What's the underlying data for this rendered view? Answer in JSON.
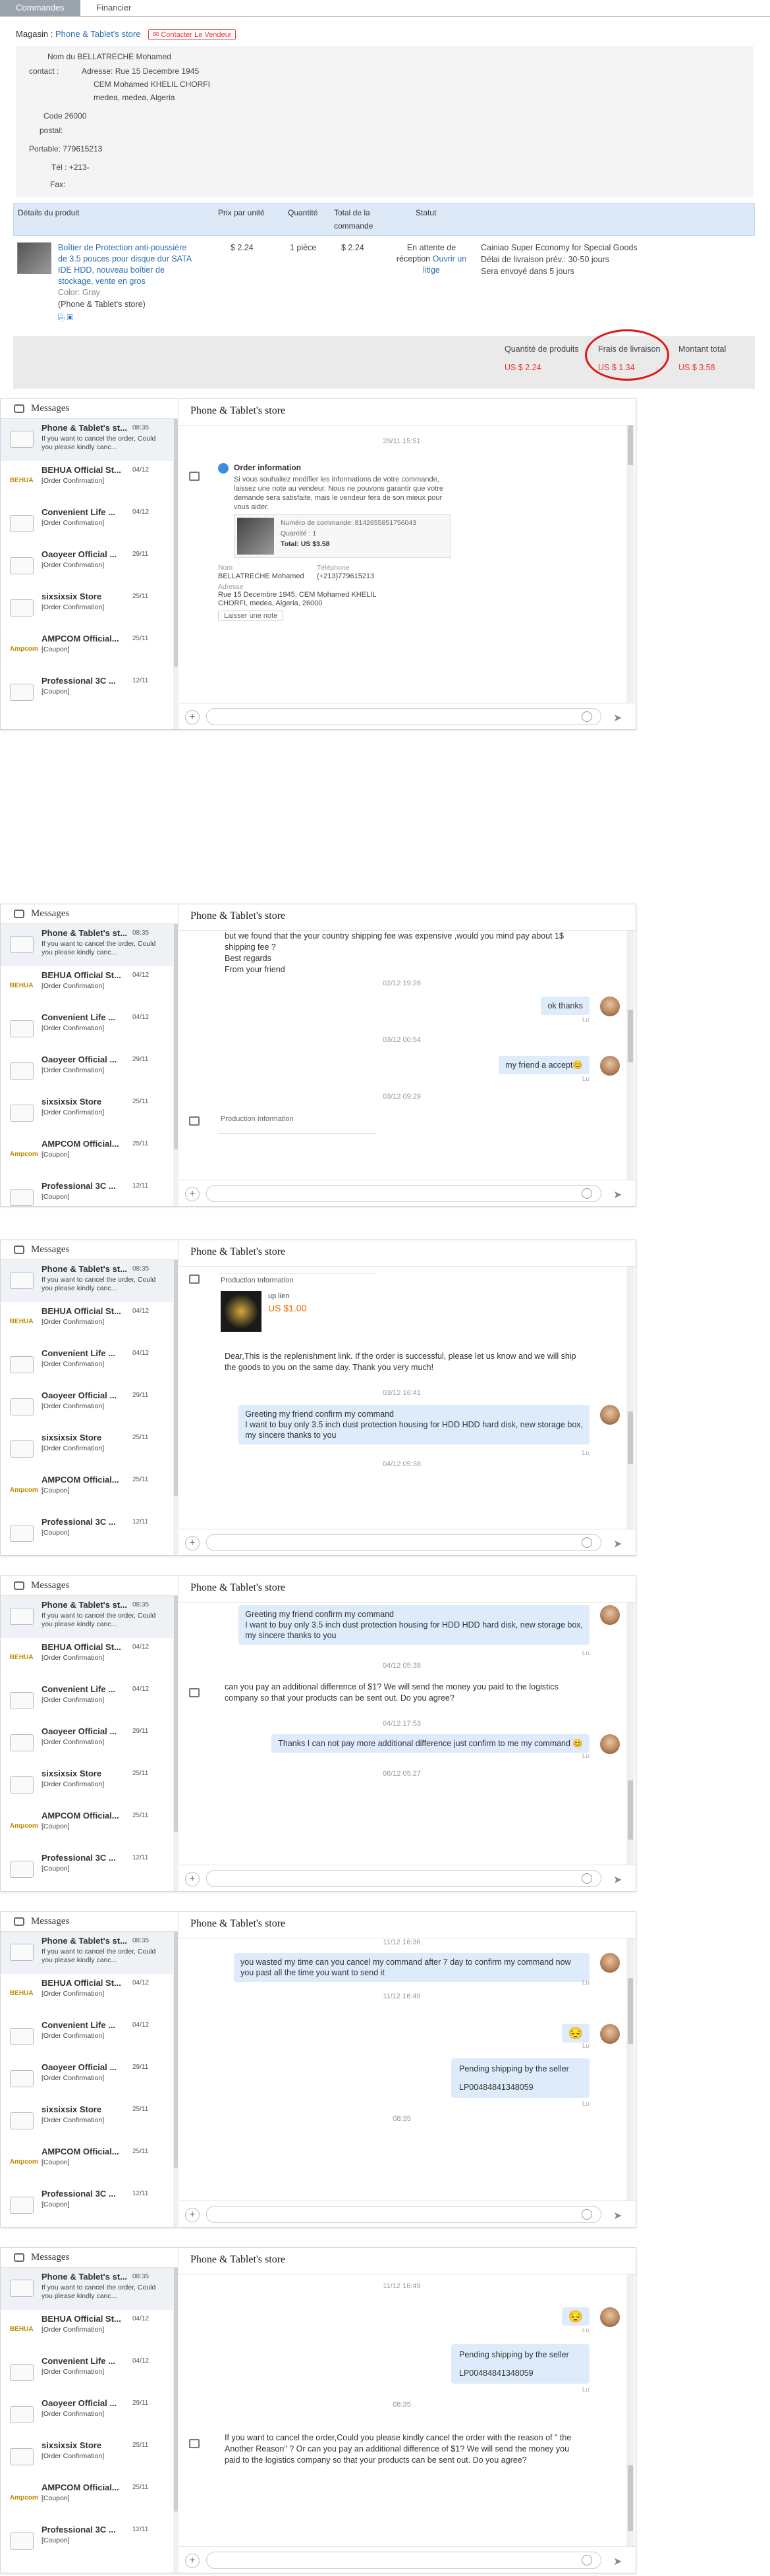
{
  "tabs": [
    "Commandes",
    "Financier"
  ],
  "store": {
    "label": "Magasin :",
    "name": "Phone & Tablet's store",
    "contact_btn": "Contacter Le Vendeur"
  },
  "address": {
    "name_k": "Nom du",
    "name_v": "BELLATRECHE Mohamed",
    "contact_k": "contact :",
    "addr_k": "Adresse:",
    "addr_v1": "Rue 15 Decembre 1945",
    "addr_v2": "CEM Mohamed KHELIL CHORFI",
    "addr_v3": "medea, medea, Algeria",
    "code_k": "Code",
    "code_v": "26000",
    "postal_k": "postal:",
    "mobile_k": "Portable:",
    "mobile_v": "779615213",
    "tel_k": "Tél :",
    "tel_v": "+213-",
    "fax_k": "Fax:"
  },
  "table": {
    "headers": [
      "Détails du produit",
      "Prix par unité",
      "Quantité",
      "Total de la commande",
      "Statut"
    ],
    "product": "Boîtier de Protection anti-poussière de 3.5 pouces pour disque dur SATA IDE HDD, nouveau boîtier de stockage, vente en gros",
    "color_label": "Color:",
    "color_value": "Gray",
    "seller": "(Phone & Tablet's store)",
    "unit_price": "$ 2.24",
    "qty": "1 pièce",
    "total": "$ 2.24",
    "status": "En attente de réception",
    "status_link": "Ouvrir un litige",
    "shipping": "Cainiao Super Economy for Special Goods",
    "delivery": "Délai de livraison prév.: 30-50 jours",
    "sent": "Sera envoyé dans 5 jours"
  },
  "totals": {
    "qty_label": "Quantité de produits",
    "qty_value": "US $ 2.24",
    "ship_label": "Frais de livraison",
    "ship_value": "US $ 1.34",
    "total_label": "Montant total",
    "total_value": "US $ 3.58"
  },
  "chat": {
    "messages_title": "Messages",
    "store_title": "Phone & Tablet's store",
    "conversations": [
      {
        "name": "Phone & Tablet's st...",
        "date": "08:35",
        "sub": "If you want to cancel the order, Could you please kindly canc...",
        "logo": ""
      },
      {
        "name": "BEHUA Official St...",
        "date": "04/12",
        "sub": "[Order Confirmation]",
        "logo": "BEHUA"
      },
      {
        "name": "Convenient Life ...",
        "date": "04/12",
        "sub": "[Order Confirmation]",
        "logo": ""
      },
      {
        "name": "Oaoyeer Official ...",
        "date": "29/11",
        "sub": "[Order Confirmation]",
        "logo": ""
      },
      {
        "name": "sixsixsix Store",
        "date": "25/11",
        "sub": "[Order Confirmation]",
        "logo": ""
      },
      {
        "name": "AMPCOM Official...",
        "date": "25/11",
        "sub": "[Coupon]",
        "logo": "Ampcom"
      },
      {
        "name": "Professional 3C ...",
        "date": "12/11",
        "sub": "[Coupon]",
        "logo": ""
      }
    ],
    "p1": {
      "ts": "29/11 15:51",
      "order_info": "Order information",
      "order_text": "Si vous souhaitez modifier les informations de votre commande, laissez une note au vendeur. Nous ne pouvons garantir que votre demande sera satisfaite, mais le vendeur fera de son mieux pour vous aider.",
      "order_no": "Numéro de commande: 8142655851756043",
      "qty": "Quantité : 1",
      "total": "Total: US $3.58",
      "name_k": "Nom",
      "phone_k": "Téléphone",
      "name_v": "BELLATRECHE Mohamed",
      "phone_v": "(+213)779615213",
      "addr_k": "Adresse",
      "addr_v": "Rue 15 Decembre 1945, CEM Mohamed KHELIL CHORFI, medea, Algeria, 26000",
      "note_btn": "Laisser une note"
    },
    "p2": {
      "top_text": "but we found that the your country shipping fee was expensive ,would you mind pay about 1$ shipping fee ?\nBest regards\nFrom your friend",
      "ts1": "02/12 19:26",
      "m1": "ok thanks",
      "ts2": "03/12 00:54",
      "m2": "my friend a accept😊",
      "ts3": "03/12 09:29",
      "prod_info": "Production Information",
      "lu": "Lu"
    },
    "p3": {
      "prod_info": "Production Information",
      "link_label": "up lien",
      "link_price": "US $1.00",
      "seller_text": "Dear,This is the replenishment link.  If the order is successful, please let us know and we will ship the goods to you on the same day. Thank you very much!",
      "ts1": "03/12 16:41",
      "m1": "Greeting my friend confirm my command\nI want to buy only 3.5 inch dust protection housing for HDD HDD hard disk, new storage box,\nmy sincere thanks to you",
      "ts2": "04/12 05:38"
    },
    "p4": {
      "m1": "Greeting my friend confirm my command\nI want to buy only 3.5 inch dust protection housing for HDD HDD hard disk, new storage box,\nmy sincere thanks to you",
      "ts1": "04/12 05:38",
      "seller": "can you pay an additional difference of $1? We will send the money you paid to the logistics company so that your products can be sent out. Do you agree?",
      "ts2": "04/12 17:53",
      "m2": "Thanks I can not pay more additional difference just confirm to me my command 😊",
      "ts3": "06/12 05:27"
    },
    "p5": {
      "ts1": "11/12 16:36",
      "m1": "you wasted my time can you cancel my command after 7 day to confirm my command  now you past all the time you want to send it",
      "ts2": "11/12 16:49",
      "m2": "😔",
      "m3a": "Pending shipping by the seller",
      "m3b": "LP00484841348059",
      "ts3": "08:35"
    },
    "p6": {
      "ts1": "11/12 16:49",
      "m1": "😔",
      "m2a": "Pending shipping by the seller",
      "m2b": "LP00484841348059",
      "ts2": "08:35",
      "seller": "If you want to cancel the order,Could you please kindly cancel the order with the reason of \" the Another Reason\" ?  Or can you pay an additional difference of $1? We will send the money you paid to the logistics company so that your products can be sent out.  Do you agree?"
    }
  }
}
